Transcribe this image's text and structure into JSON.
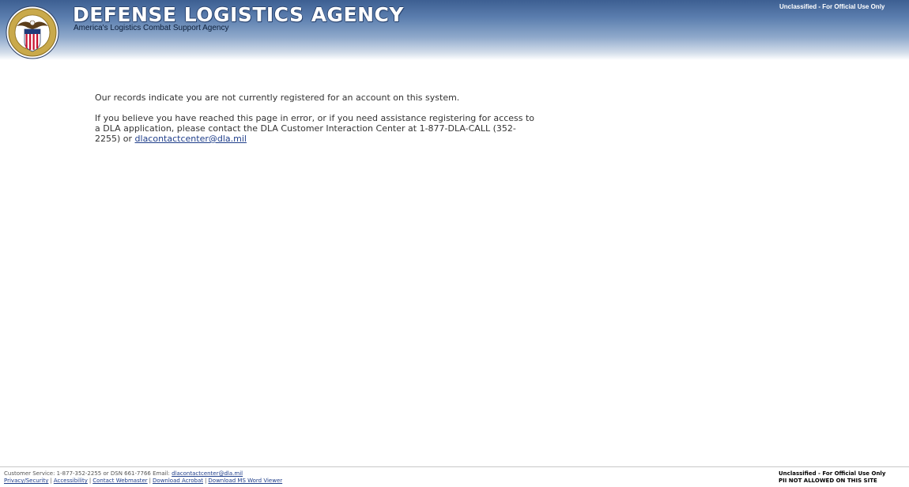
{
  "header": {
    "title": "DEFENSE LOGISTICS AGENCY",
    "subtitle": "America's Logistics Combat Support Agency",
    "classification": "Unclassified - For Official Use Only",
    "seal_icon": "dla-seal-icon"
  },
  "message": {
    "line1": "Our records indicate you are not currently registered for an account on this system.",
    "para2_text": "If you believe you have reached this page in error, or if you need assistance registering for access to a DLA application, please contact the DLA Customer Interaction Center at 1-877-DLA-CALL (352-2255) or ",
    "email_link": "dlacontactcenter@dla.mil"
  },
  "footer": {
    "customer_service_text": "Customer Service: 1-877-352-2255 or DSN 661-7766 Email: ",
    "email_link": "dlacontactcenter@dla.mil",
    "links": [
      "Privacy/Security",
      "Accessibility",
      "Contact Webmaster",
      "Download Acrobat",
      "Download MS Word Viewer"
    ],
    "link_separator": "|",
    "classification": "Unclassified - For Official Use Only",
    "pii_notice": "PII NOT ALLOWED ON THIS SITE"
  },
  "colors": {
    "header_dark": "#3d5f92",
    "link": "#1f3e8a",
    "body_text": "#333333"
  }
}
